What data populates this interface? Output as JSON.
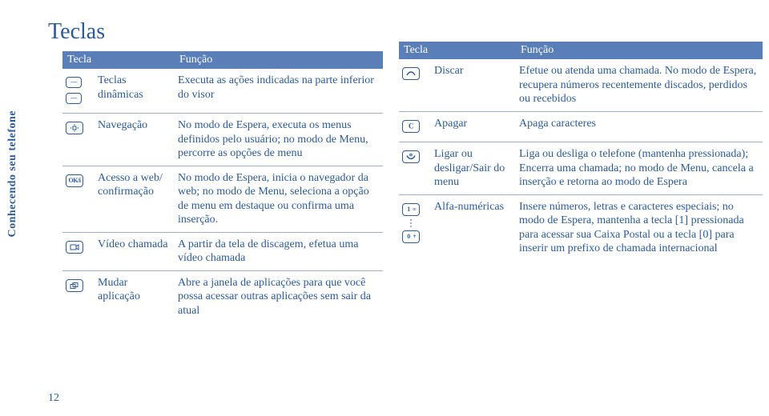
{
  "page_title": "Teclas",
  "sidebar_label": "Conhecendo seu telefone",
  "page_number": "12",
  "left": {
    "headers": {
      "col1": "Tecla",
      "col2": "Função"
    },
    "rows": [
      {
        "key": "Teclas dinâmicas",
        "func": "Executa as ações indicadas na parte inferior do visor"
      },
      {
        "key": "Navegação",
        "func": "No modo de Espera, executa os menus definidos pelo usuário; no modo de Menu, percorre as opções de menu"
      },
      {
        "key": "Acesso a web/ confirmação",
        "func": "No modo de Espera, inicia o navegador da web; no modo de Menu, seleciona a opção de menu em destaque ou confirma uma inserção."
      },
      {
        "key": "Vídeo chamada",
        "func": "A partir da tela de discagem, efetua uma vídeo chamada"
      },
      {
        "key": "Mudar aplicação",
        "func": "Abre a janela de aplicações para que você possa acessar outras aplicações sem sair da atual"
      }
    ]
  },
  "right": {
    "headers": {
      "col1": "Tecla",
      "col2": "Função"
    },
    "rows": [
      {
        "key": "Discar",
        "func": "Efetue ou atenda uma chamada. No modo de Espera, recupera números recentemente discados, perdidos ou recebidos"
      },
      {
        "key": "Apagar",
        "func": "Apaga caracteres"
      },
      {
        "key": "Ligar ou desligar/Sair do menu",
        "func": "Liga ou desliga o telefone (mantenha pressionada); Encerra uma chamada; no modo de Menu, cancela a inserção e retorna ao modo de Espera"
      },
      {
        "key": "Alfa-numéricas",
        "func": "Insere números, letras e caracteres especiais; no modo de Espera, mantenha a tecla [1] pressionada para acessar sua Caixa Postal ou a tecla [0] para inserir um prefixo de chamada internacional"
      }
    ]
  }
}
